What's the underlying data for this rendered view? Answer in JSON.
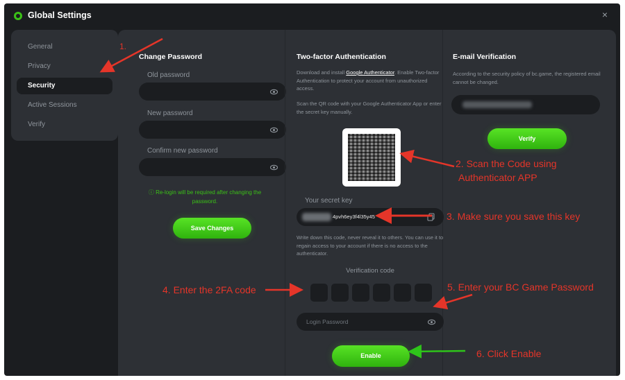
{
  "window": {
    "title": "Global Settings",
    "close_symbol": "×"
  },
  "sidebar": {
    "items": [
      {
        "label": "General"
      },
      {
        "label": "Privacy"
      },
      {
        "label": "Security"
      },
      {
        "label": "Active Sessions"
      },
      {
        "label": "Verify"
      }
    ],
    "active_item": "Security"
  },
  "change_password": {
    "title": "Change Password",
    "old_label": "Old password",
    "new_label": "New password",
    "confirm_label": "Confirm new password",
    "note": "Re-login will be required after changing the password.",
    "save_label": "Save Changes"
  },
  "twofa": {
    "title": "Two-factor Authentication",
    "desc_prefix": "Download and install ",
    "desc_link": "Google Authenticator",
    "desc_suffix": ". Enable Two-factor Authentication to protect your account from unauthorized access.",
    "scan_desc": "Scan the QR code with your Google Authenticator App or enter the secret key manually.",
    "secret_label": "Your secret key",
    "secret_value": "4pvh6ey3f4l35y45",
    "warning": "Write down this code, never reveal it to others. You can use it to regain access to your account if there is no access to the authenticator.",
    "verification_label": "Verification code",
    "login_password_placeholder": "Login Password",
    "enable_label": "Enable"
  },
  "email": {
    "title": "E-mail Verification",
    "desc": "According to the security policy of bc.game, the registered email cannot be changed.",
    "verify_label": "Verify"
  },
  "annotations": {
    "a1": "1.",
    "a2": "2. Scan the Code using",
    "a2b": "Authenticator APP",
    "a3": "3. Make sure you save this key",
    "a4": "4. Enter the 2FA code",
    "a5": "5. Enter your BC Game Password",
    "a6": "6. Click Enable"
  },
  "colors": {
    "accent": "#3bc117",
    "background": "#1b1d20",
    "panel": "#2d3035",
    "annotation": "#e53529",
    "arrow_green": "#2ec41a"
  }
}
